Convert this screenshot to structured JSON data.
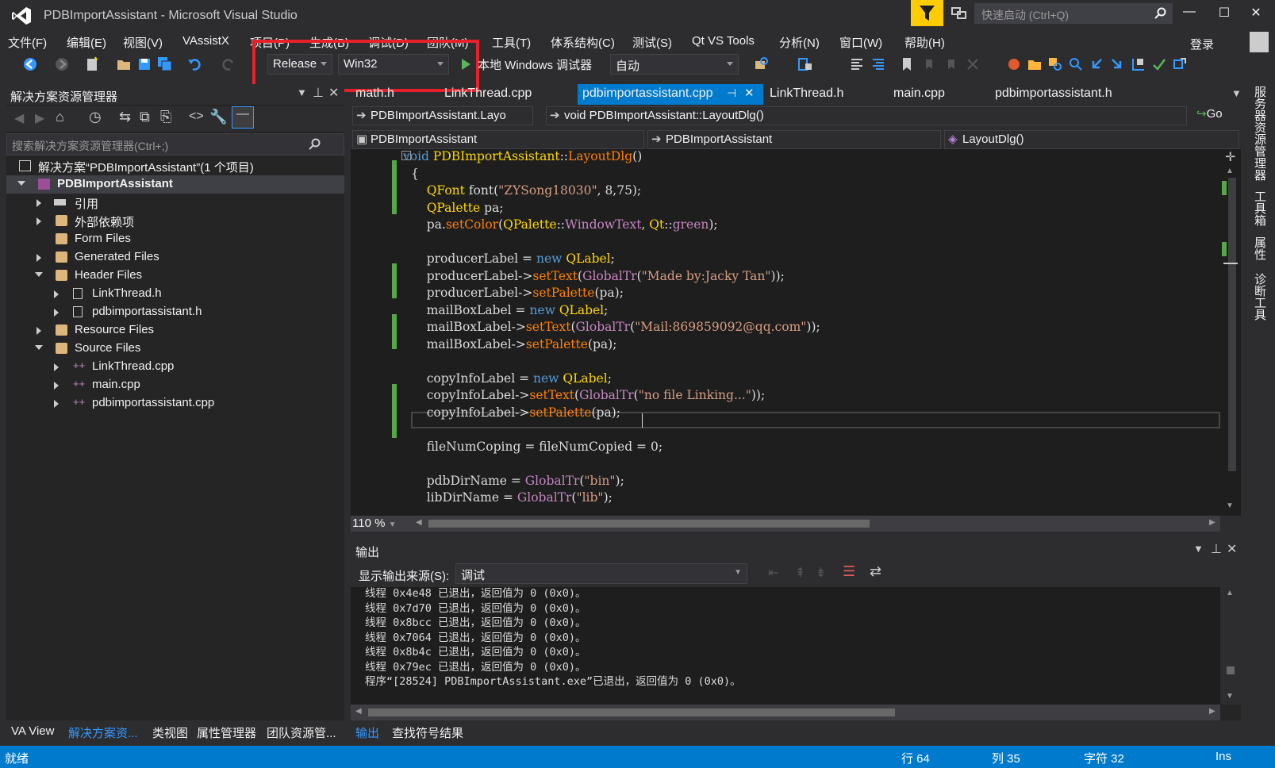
{
  "window": {
    "title": "PDBImportAssistant - Microsoft Visual Studio",
    "quicklaunch_placeholder": "快速启动 (Ctrl+Q)"
  },
  "menu": [
    "文件(F)",
    "编辑(E)",
    "视图(V)",
    "VAssistX",
    "项目(P)",
    "生成(B)",
    "调试(D)",
    "团队(M)",
    "工具(T)",
    "体系结构(C)",
    "测试(S)",
    "Qt VS Tools",
    "分析(N)",
    "窗口(W)",
    "帮助(H)"
  ],
  "login": "登录",
  "toolbar": {
    "config": "Release",
    "platform": "Win32",
    "debugger": "本地 Windows 调试器",
    "auto": "自动"
  },
  "solution_explorer": {
    "title": "解决方案资源管理器",
    "search_placeholder": "搜索解决方案资源管理器(Ctrl+;)",
    "items": [
      {
        "label": "解决方案“PDBImportAssistant”(1 个项目)"
      },
      {
        "label": "PDBImportAssistant"
      },
      {
        "label": "引用"
      },
      {
        "label": "外部依赖项"
      },
      {
        "label": "Form Files"
      },
      {
        "label": "Generated Files"
      },
      {
        "label": "Header Files"
      },
      {
        "label": "LinkThread.h"
      },
      {
        "label": "pdbimportassistant.h"
      },
      {
        "label": "Resource Files"
      },
      {
        "label": "Source Files"
      },
      {
        "label": "LinkThread.cpp"
      },
      {
        "label": "main.cpp"
      },
      {
        "label": "pdbimportassistant.cpp"
      }
    ]
  },
  "left_tabs": [
    "VA View",
    "解决方案资...",
    "类视图",
    "属性管理器",
    "团队资源管..."
  ],
  "doc_tabs": [
    "math.h",
    "LinkThread.cpp",
    "pdbimportassistant.cpp",
    "LinkThread.h",
    "main.cpp",
    "pdbimportassistant.h"
  ],
  "nav": {
    "scope": "PDBImportAssistant.Layo",
    "function": "void PDBImportAssistant::LayoutDlg()",
    "go": "Go",
    "project": "PDBImportAssistant",
    "class": "PDBImportAssistant",
    "member": "LayoutDlg()"
  },
  "code": [
    "void PDBImportAssistant::LayoutDlg()",
    "{",
    "    QFont font(\"ZYSong18030\", 8,75);",
    "    QPalette pa;",
    "    pa.setColor(QPalette::WindowText, Qt::green);",
    "",
    "    producerLabel = new QLabel;",
    "    producerLabel->setText(GlobalTr(\"Made by:Jacky Tan\"));",
    "    producerLabel->setPalette(pa);",
    "    mailBoxLabel = new QLabel;",
    "    mailBoxLabel->setText(GlobalTr(\"Mail:869859092@qq.com\"));",
    "    mailBoxLabel->setPalette(pa);",
    "",
    "    copyInfoLabel = new QLabel;",
    "    copyInfoLabel->setText(GlobalTr(\"no file Linking...\"));",
    "    copyInfoLabel->setPalette(pa);",
    "",
    "    fileNumCoping = fileNumCopied = 0;",
    "",
    "    pdbDirName = GlobalTr(\"bin\");",
    "    libDirName = GlobalTr(\"lib\");"
  ],
  "zoom": "110 %",
  "output": {
    "title": "输出",
    "source_label": "显示输出来源(S):",
    "source": "调试",
    "lines": [
      "线程 0x4e48 已退出，返回值为 0 (0x0)。",
      "线程 0x7d70 已退出，返回值为 0 (0x0)。",
      "线程 0x8bcc 已退出，返回值为 0 (0x0)。",
      "线程 0x7064 已退出，返回值为 0 (0x0)。",
      "线程 0x8b4c 已退出，返回值为 0 (0x0)。",
      "线程 0x79ec 已退出，返回值为 0 (0x0)。",
      "程序“[28524] PDBImportAssistant.exe”已退出，返回值为 0 (0x0)。"
    ]
  },
  "bottom_tabs": [
    "输出",
    "查找符号结果"
  ],
  "right_tabs": [
    "服务器资源管理器",
    "工具箱",
    "属性",
    "诊断工具"
  ],
  "status": {
    "ready": "就绪",
    "line": "行 64",
    "col": "列 35",
    "char": "字符 32",
    "mode": "Ins"
  },
  "colors": {
    "accent": "#007acc",
    "highlight": "#e8202a",
    "keyword": "#569cd6",
    "string": "#d69d85",
    "type": "#ffd700",
    "method": "#ff8000"
  }
}
